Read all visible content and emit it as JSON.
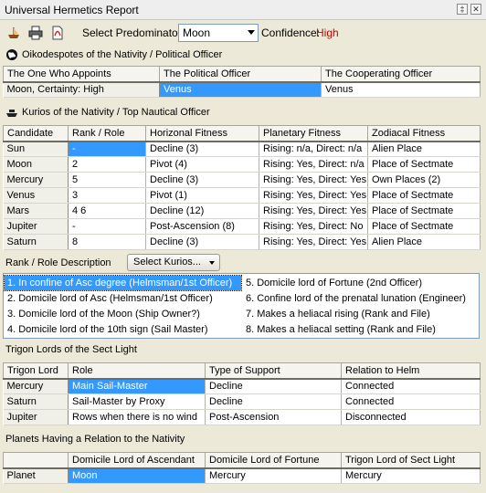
{
  "window": {
    "title": "Universal Hermetics Report"
  },
  "toolbar": {
    "predominator_label": "Select Predominator:",
    "predominator_value": "Moon",
    "confidence_label": "Confidence:",
    "confidence_value": "High",
    "confidence_color": "#cc0000"
  },
  "oikodespotes": {
    "heading": "Oikodespotes of the Nativity / Political Officer",
    "columns": [
      "The One Who Appoints",
      "The Political Officer",
      "The Cooperating Officer"
    ],
    "row": [
      "Moon, Certainty: High",
      "Venus",
      "Venus"
    ]
  },
  "kurios": {
    "heading": "Kurios of the Nativity / Top Nautical Officer",
    "columns": [
      "Candidate",
      "Rank / Role",
      "Horizonal Fitness",
      "Planetary Fitness",
      "Zodiacal Fitness"
    ],
    "rows": [
      [
        "Sun",
        "-",
        "Decline (3)",
        "Rising: n/a, Direct: n/a",
        "Alien Place"
      ],
      [
        "Moon",
        "2",
        "Pivot (4)",
        "Rising: Yes, Direct: n/a",
        "Place of Sectmate"
      ],
      [
        "Mercury",
        "5",
        "Decline (3)",
        "Rising: Yes, Direct: Yes",
        "Own Places (2)"
      ],
      [
        "Venus",
        "3",
        "Pivot (1)",
        "Rising: Yes, Direct: Yes",
        "Place of Sectmate"
      ],
      [
        "Mars",
        "4 6",
        "Decline (12)",
        "Rising: Yes, Direct: Yes",
        "Place of Sectmate"
      ],
      [
        "Jupiter",
        "-",
        "Post-Ascension (8)",
        "Rising: Yes, Direct: No",
        "Place of Sectmate"
      ],
      [
        "Saturn",
        "8",
        "Decline (3)",
        "Rising: Yes, Direct: Yes",
        "Alien Place"
      ]
    ]
  },
  "rank_role": {
    "label": "Rank / Role Description",
    "button": "Select Kurios...",
    "items_left": [
      "1. In confine of Asc degree (Helmsman/1st Officer)",
      "2. Domicile lord of Asc (Helmsman/1st Officer)",
      "3. Domicile lord of the Moon (Ship Owner?)",
      "4. Domicile lord of the 10th sign (Sail Master)"
    ],
    "items_right": [
      "5. Domicile lord of Fortune (2nd Officer)",
      "6. Confine lord of the prenatal lunation (Engineer)",
      "7. Makes a heliacal rising (Rank and File)",
      "8. Makes a heliacal setting (Rank and File)"
    ]
  },
  "trigon": {
    "heading": "Trigon Lords of the Sect Light",
    "columns": [
      "Trigon Lord",
      "Role",
      "Type of Support",
      "Relation to Helm"
    ],
    "rows": [
      [
        "Mercury",
        "Main Sail-Master",
        "Decline",
        "Connected"
      ],
      [
        "Saturn",
        "Sail-Master by Proxy",
        "Decline",
        "Connected"
      ],
      [
        "Jupiter",
        "Rows when there is no wind",
        "Post-Ascension",
        "Disconnected"
      ]
    ]
  },
  "planets_relation": {
    "heading": "Planets Having a Relation to the Nativity",
    "columns": [
      "",
      "Domicile Lord of Ascendant",
      "Domicile Lord of Fortune",
      "Trigon Lord of Sect Light"
    ],
    "row": [
      "Planet",
      "Moon",
      "Mercury",
      "Mercury"
    ]
  },
  "accent": "#3399ff"
}
